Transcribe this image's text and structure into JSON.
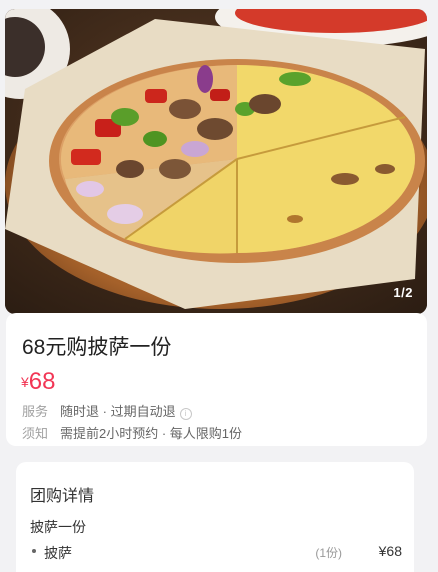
{
  "gallery": {
    "counter": "1/2"
  },
  "deal": {
    "title": "68元购披萨一份",
    "price_currency": "¥",
    "price_value": "68",
    "service_label": "服务",
    "service_value": "随时退 · 过期自动退",
    "notice_label": "须知",
    "notice_value": "需提前2小时预约 · 每人限购1份"
  },
  "details": {
    "title": "团购详情",
    "group_name": "披萨一份",
    "items": [
      {
        "name": "披萨",
        "qty": "(1份)",
        "price": "¥68"
      }
    ]
  },
  "colors": {
    "price": "#f23655"
  }
}
